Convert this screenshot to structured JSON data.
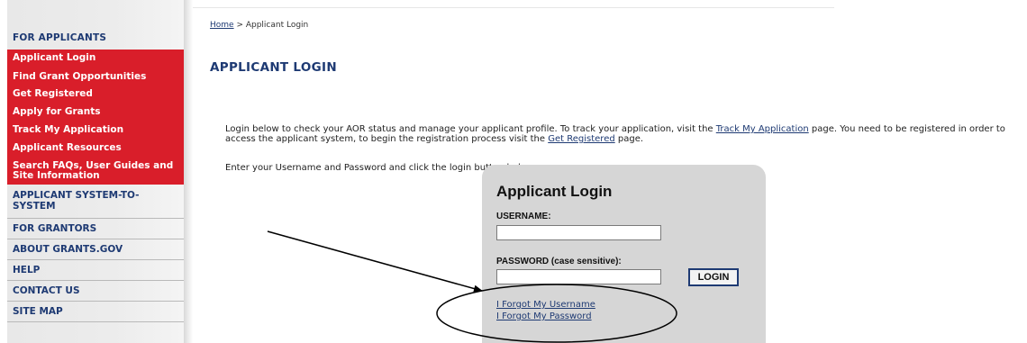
{
  "sidebar": {
    "section_header": "FOR APPLICANTS",
    "red_items": [
      {
        "label": "Applicant Login"
      },
      {
        "label": "Find Grant Opportunities"
      },
      {
        "label": "Get Registered"
      },
      {
        "label": "Apply for Grants"
      },
      {
        "label": "Track My Application"
      },
      {
        "label": "Applicant Resources"
      },
      {
        "label": "Search FAQs, User Guides and Site Information"
      }
    ],
    "gray_items": [
      {
        "label": "APPLICANT SYSTEM-TO-SYSTEM"
      },
      {
        "label": "FOR GRANTORS"
      },
      {
        "label": "ABOUT GRANTS.GOV"
      },
      {
        "label": "HELP"
      },
      {
        "label": "CONTACT US"
      },
      {
        "label": "SITE MAP"
      }
    ]
  },
  "breadcrumb": {
    "home": "Home",
    "separator": " > ",
    "current": "Applicant Login"
  },
  "page_title": "APPLICANT LOGIN",
  "intro": {
    "part1": "Login below to check your AOR status and manage your applicant profile. To track your application, visit the ",
    "link1": "Track My Application",
    "part2": " page. You need to be registered in order to access the applicant system, to begin the registration process visit the ",
    "link2": "Get Registered",
    "part3": " page."
  },
  "instruction": "Enter your Username and Password and click the login button below.",
  "login_box": {
    "title": "Applicant Login",
    "username_label": "USERNAME:",
    "username_value": "",
    "password_label": "PASSWORD (case sensitive):",
    "password_value": "",
    "login_button": "LOGIN",
    "forgot_username": "I Forgot My Username",
    "forgot_password": "I Forgot My Password"
  },
  "colors": {
    "sidebar_red": "#d91e2a",
    "nav_blue": "#1e3a73",
    "login_box_gray": "#d6d6d6"
  }
}
